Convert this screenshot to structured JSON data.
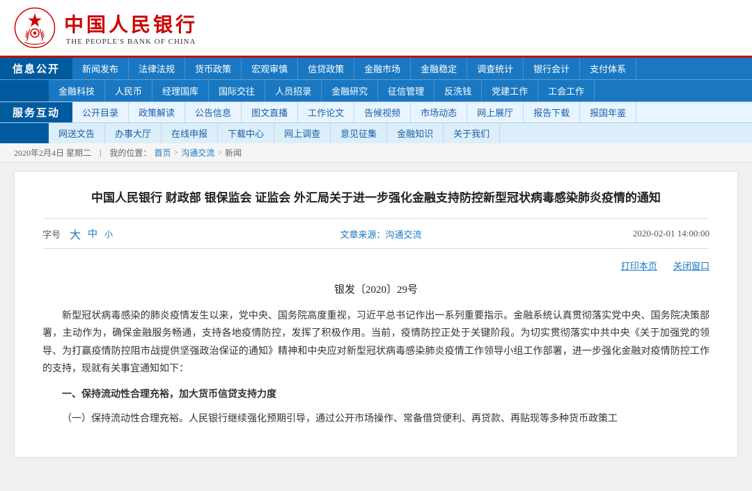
{
  "header": {
    "logo_cn": "中国人民银行",
    "logo_en": "THE PEOPLE'S BANK OF CHINA"
  },
  "nav": {
    "section1_label": "信息公开",
    "row1_items": [
      "新闻发布",
      "法律法规",
      "货币政策",
      "宏观审慎",
      "信贷政策",
      "金融市场",
      "金融稳定",
      "调查统计",
      "银行会计",
      "支付体系"
    ],
    "row2_items": [
      "金融科技",
      "人民币",
      "经理国库",
      "国际交往",
      "人员招录",
      "金融研究",
      "征信管理",
      "反洗钱",
      "党建工作",
      "工会工作"
    ],
    "section2_label": "服务互动",
    "row3_items": [
      "公开目录",
      "政策解读",
      "公告信息",
      "图文直播",
      "工作论文",
      "告候视频",
      "市场动态",
      "网上展厅",
      "报告下载",
      "报国年鉴"
    ],
    "row4_items": [
      "网送文告",
      "办事大厅",
      "在线申报",
      "下载中心",
      "网上调查",
      "意见征集",
      "金融知识",
      "关于我们"
    ]
  },
  "breadcrumb": {
    "date": "2020年2月4日 星期二",
    "location_label": "我的位置：",
    "home": "首页",
    "section": "沟通交流",
    "current": "新闻"
  },
  "article": {
    "title": "中国人民银行 财政部 银保监会 证监会 外汇局关于进一步强化金融支持防控新型冠状病毒感染肺炎疫情的通知",
    "font_label": "字号",
    "font_large": "大",
    "font_medium": "中",
    "font_small": "小",
    "source_label": "文章来源：",
    "source": "沟通交流",
    "date": "2020-02-01 14:00:00",
    "print": "打印本页",
    "close": "关闭窗口",
    "doc_num": "银发〔2020〕29号",
    "para1": "新型冠状病毒感染的肺炎疫情发生以来，党中央、国务院高度重视，习近平总书记作出一系列重要指示。金融系统认真贯彻落实党中央、国务院决策部署，主动作为，确保金融服务畅通，支持各地疫情防控，发挥了积极作用。当前，疫情防控正处于关键阶段。为切实贯彻落实中共中央《关于加强党的领导、为打赢疫情防控阻市战提供坚强政治保证的通知》精神和中央应对新型冠状病毒感染肺炎疫情工作领导小组工作部署，进一步强化金融对疫情防控工作的支持，现就有关事宜通知如下：",
    "section1_heading": "一、保持流动性合理充裕，加大货币信贷支持力度",
    "para2": "（一）保持流动性合理充裕。人民银行继续强化预期引导，通过公开市场操作、常备借贷便利、再贷款、再贴现等多种货币政策工"
  }
}
